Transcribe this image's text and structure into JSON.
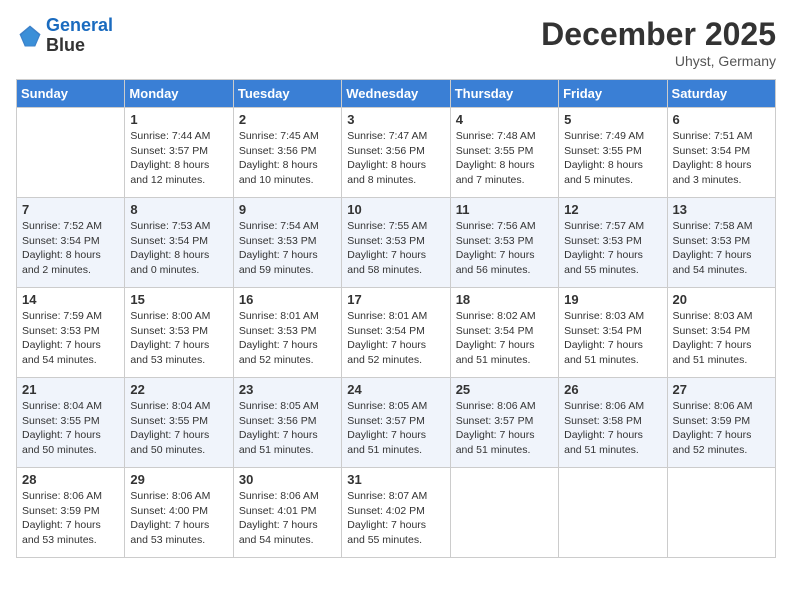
{
  "header": {
    "logo_line1": "General",
    "logo_line2": "Blue",
    "month": "December 2025",
    "location": "Uhyst, Germany"
  },
  "days_of_week": [
    "Sunday",
    "Monday",
    "Tuesday",
    "Wednesday",
    "Thursday",
    "Friday",
    "Saturday"
  ],
  "weeks": [
    [
      {
        "day": "",
        "info": ""
      },
      {
        "day": "1",
        "info": "Sunrise: 7:44 AM\nSunset: 3:57 PM\nDaylight: 8 hours\nand 12 minutes."
      },
      {
        "day": "2",
        "info": "Sunrise: 7:45 AM\nSunset: 3:56 PM\nDaylight: 8 hours\nand 10 minutes."
      },
      {
        "day": "3",
        "info": "Sunrise: 7:47 AM\nSunset: 3:56 PM\nDaylight: 8 hours\nand 8 minutes."
      },
      {
        "day": "4",
        "info": "Sunrise: 7:48 AM\nSunset: 3:55 PM\nDaylight: 8 hours\nand 7 minutes."
      },
      {
        "day": "5",
        "info": "Sunrise: 7:49 AM\nSunset: 3:55 PM\nDaylight: 8 hours\nand 5 minutes."
      },
      {
        "day": "6",
        "info": "Sunrise: 7:51 AM\nSunset: 3:54 PM\nDaylight: 8 hours\nand 3 minutes."
      }
    ],
    [
      {
        "day": "7",
        "info": "Sunrise: 7:52 AM\nSunset: 3:54 PM\nDaylight: 8 hours\nand 2 minutes."
      },
      {
        "day": "8",
        "info": "Sunrise: 7:53 AM\nSunset: 3:54 PM\nDaylight: 8 hours\nand 0 minutes."
      },
      {
        "day": "9",
        "info": "Sunrise: 7:54 AM\nSunset: 3:53 PM\nDaylight: 7 hours\nand 59 minutes."
      },
      {
        "day": "10",
        "info": "Sunrise: 7:55 AM\nSunset: 3:53 PM\nDaylight: 7 hours\nand 58 minutes."
      },
      {
        "day": "11",
        "info": "Sunrise: 7:56 AM\nSunset: 3:53 PM\nDaylight: 7 hours\nand 56 minutes."
      },
      {
        "day": "12",
        "info": "Sunrise: 7:57 AM\nSunset: 3:53 PM\nDaylight: 7 hours\nand 55 minutes."
      },
      {
        "day": "13",
        "info": "Sunrise: 7:58 AM\nSunset: 3:53 PM\nDaylight: 7 hours\nand 54 minutes."
      }
    ],
    [
      {
        "day": "14",
        "info": "Sunrise: 7:59 AM\nSunset: 3:53 PM\nDaylight: 7 hours\nand 54 minutes."
      },
      {
        "day": "15",
        "info": "Sunrise: 8:00 AM\nSunset: 3:53 PM\nDaylight: 7 hours\nand 53 minutes."
      },
      {
        "day": "16",
        "info": "Sunrise: 8:01 AM\nSunset: 3:53 PM\nDaylight: 7 hours\nand 52 minutes."
      },
      {
        "day": "17",
        "info": "Sunrise: 8:01 AM\nSunset: 3:54 PM\nDaylight: 7 hours\nand 52 minutes."
      },
      {
        "day": "18",
        "info": "Sunrise: 8:02 AM\nSunset: 3:54 PM\nDaylight: 7 hours\nand 51 minutes."
      },
      {
        "day": "19",
        "info": "Sunrise: 8:03 AM\nSunset: 3:54 PM\nDaylight: 7 hours\nand 51 minutes."
      },
      {
        "day": "20",
        "info": "Sunrise: 8:03 AM\nSunset: 3:54 PM\nDaylight: 7 hours\nand 51 minutes."
      }
    ],
    [
      {
        "day": "21",
        "info": "Sunrise: 8:04 AM\nSunset: 3:55 PM\nDaylight: 7 hours\nand 50 minutes."
      },
      {
        "day": "22",
        "info": "Sunrise: 8:04 AM\nSunset: 3:55 PM\nDaylight: 7 hours\nand 50 minutes."
      },
      {
        "day": "23",
        "info": "Sunrise: 8:05 AM\nSunset: 3:56 PM\nDaylight: 7 hours\nand 51 minutes."
      },
      {
        "day": "24",
        "info": "Sunrise: 8:05 AM\nSunset: 3:57 PM\nDaylight: 7 hours\nand 51 minutes."
      },
      {
        "day": "25",
        "info": "Sunrise: 8:06 AM\nSunset: 3:57 PM\nDaylight: 7 hours\nand 51 minutes."
      },
      {
        "day": "26",
        "info": "Sunrise: 8:06 AM\nSunset: 3:58 PM\nDaylight: 7 hours\nand 51 minutes."
      },
      {
        "day": "27",
        "info": "Sunrise: 8:06 AM\nSunset: 3:59 PM\nDaylight: 7 hours\nand 52 minutes."
      }
    ],
    [
      {
        "day": "28",
        "info": "Sunrise: 8:06 AM\nSunset: 3:59 PM\nDaylight: 7 hours\nand 53 minutes."
      },
      {
        "day": "29",
        "info": "Sunrise: 8:06 AM\nSunset: 4:00 PM\nDaylight: 7 hours\nand 53 minutes."
      },
      {
        "day": "30",
        "info": "Sunrise: 8:06 AM\nSunset: 4:01 PM\nDaylight: 7 hours\nand 54 minutes."
      },
      {
        "day": "31",
        "info": "Sunrise: 8:07 AM\nSunset: 4:02 PM\nDaylight: 7 hours\nand 55 minutes."
      },
      {
        "day": "",
        "info": ""
      },
      {
        "day": "",
        "info": ""
      },
      {
        "day": "",
        "info": ""
      }
    ]
  ]
}
